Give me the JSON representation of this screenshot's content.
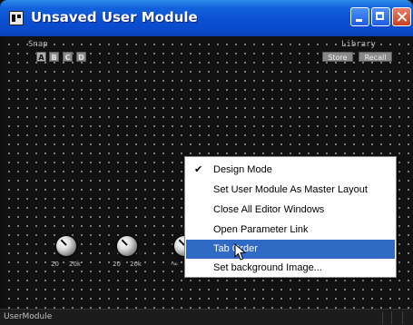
{
  "window": {
    "title": "Unsaved User Module"
  },
  "snap": {
    "label": "Snap",
    "buttons": [
      "A",
      "B",
      "C",
      "D"
    ],
    "active": "A"
  },
  "library": {
    "label": "Library",
    "store": "Store",
    "recall": "Recall"
  },
  "knobs": [
    {
      "min": "20",
      "max": "20k"
    },
    {
      "min": "20",
      "max": "20k"
    },
    {
      "min": "-∞",
      "max": ""
    }
  ],
  "context_menu": {
    "items": [
      {
        "label": "Design Mode",
        "checked": true
      },
      {
        "label": "Set User Module As Master Layout"
      },
      {
        "label": "Close All Editor Windows"
      },
      {
        "label": "Open Parameter Link"
      },
      {
        "label": "Tab Order",
        "highlighted": true
      },
      {
        "label": "Set background Image..."
      }
    ]
  },
  "status": {
    "text": "UserModule"
  },
  "colors": {
    "titlebar": "#0a4fd2",
    "menu_highlight": "#316ac5",
    "canvas": "#111111"
  }
}
